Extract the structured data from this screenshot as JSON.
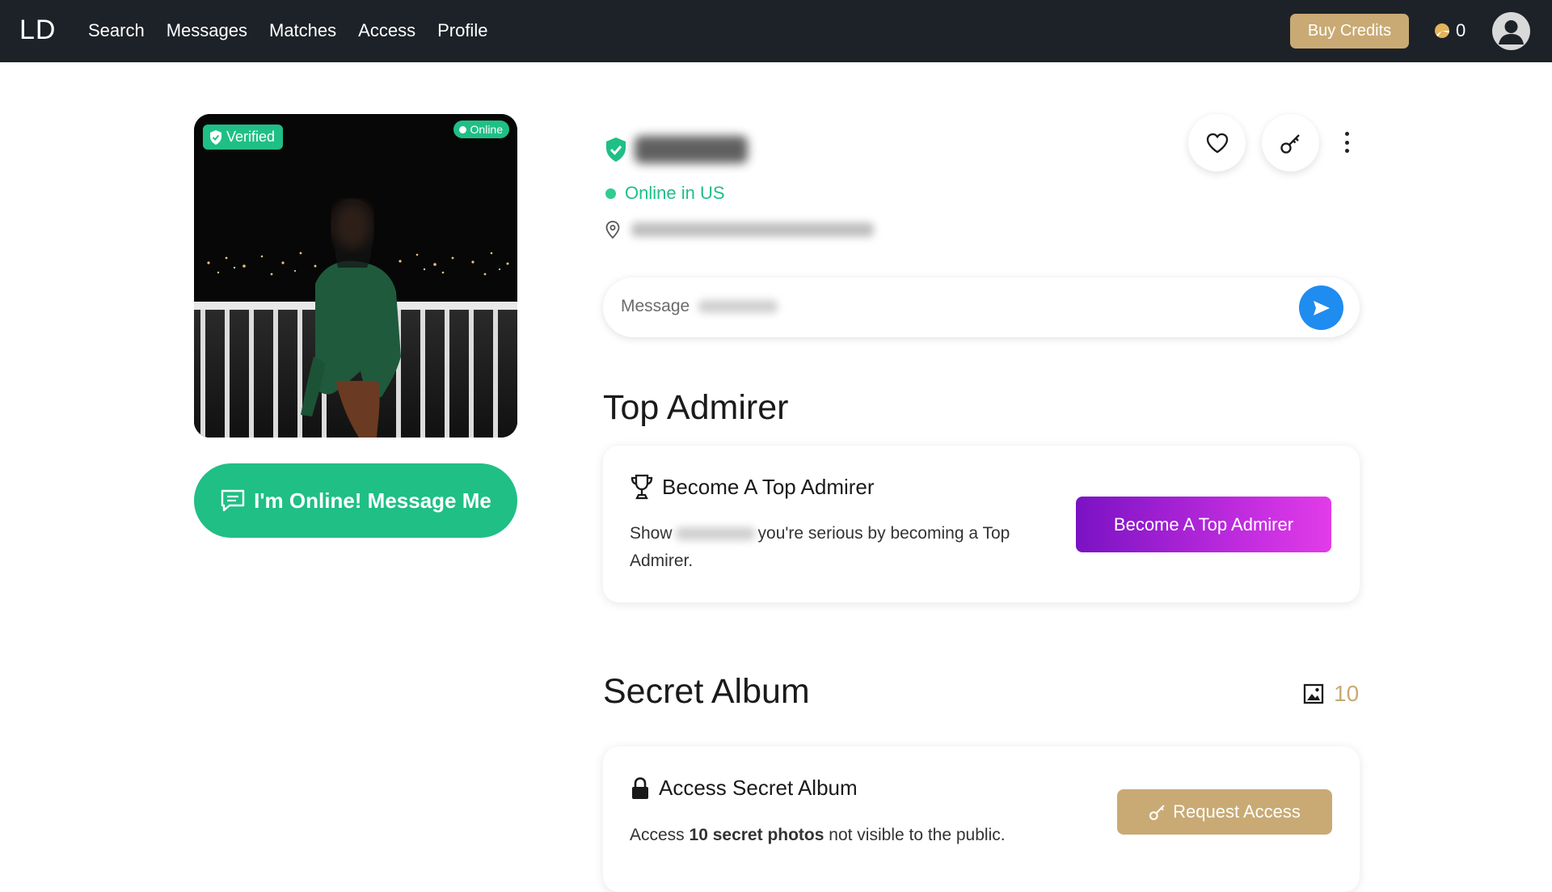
{
  "nav": {
    "logo": "LD",
    "links": [
      "Search",
      "Messages",
      "Matches",
      "Access",
      "Profile"
    ],
    "buy_credits": "Buy Credits",
    "credits_count": "0",
    "icons": {
      "credits": "credits-coin-icon",
      "avatar": "user-avatar-icon"
    }
  },
  "profile": {
    "verified_badge": "Verified",
    "online_badge": "Online",
    "status": "Online in US",
    "message_me_button": "I'm Online! Message Me",
    "message_placeholder": "Message"
  },
  "top_admirer": {
    "section_title": "Top Admirer",
    "card_title": "Become A Top Admirer",
    "text_before": "Show",
    "text_after": "you're serious by becoming a Top",
    "text_line2": "Admirer.",
    "button": "Become A Top Admirer"
  },
  "secret_album": {
    "section_title": "Secret Album",
    "photo_count": "10",
    "card_title": "Access Secret Album",
    "text_before": "Access",
    "text_bold": "10 secret photos",
    "text_after": "not visible to the public.",
    "button": "Request Access"
  },
  "colors": {
    "nav_bg": "#1d2228",
    "gold": "#c9aa74",
    "green": "#1fbf86",
    "send_blue": "#1f8cf0",
    "admirer_gradient_start": "#7a12c4",
    "admirer_gradient_end": "#e23ce8"
  }
}
